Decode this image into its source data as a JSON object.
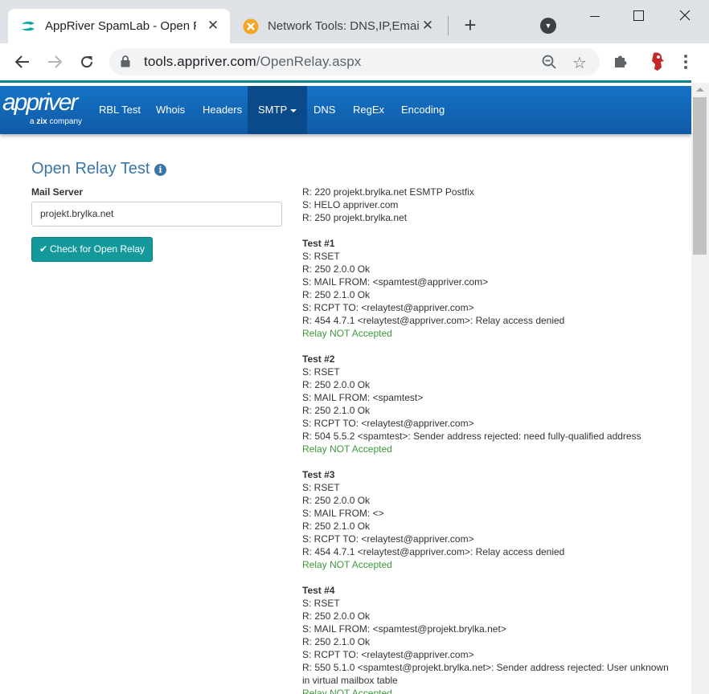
{
  "browser": {
    "tabs": [
      {
        "title": "AppRiver SpamLab - Open Relay Test",
        "active": true,
        "favicon": "appriver-favicon"
      },
      {
        "title": "Network Tools: DNS,IP,Email",
        "active": false,
        "favicon": "network-tools-favicon"
      }
    ],
    "url_host": "tools.appriver.com",
    "url_path": "/OpenRelay.aspx"
  },
  "site": {
    "logo_word": "appriver",
    "logo_tag_prefix": "a ",
    "logo_tag_brand": "zix",
    "logo_tag_suffix": " company",
    "nav": [
      {
        "label": "RBL Test"
      },
      {
        "label": "Whois"
      },
      {
        "label": "Headers"
      },
      {
        "label": "SMTP",
        "active": true
      },
      {
        "label": "DNS"
      },
      {
        "label": "RegEx"
      },
      {
        "label": "Encoding"
      }
    ]
  },
  "form": {
    "heading": "Open Relay Test",
    "mail_server_label": "Mail Server",
    "mail_server_value": "projekt.brylka.net",
    "submit_label": "Check for Open Relay"
  },
  "log": {
    "intro": [
      "R: 220 projekt.brylka.net ESMTP Postfix",
      "S: HELO appriver.com",
      "R: 250 projekt.brylka.net"
    ],
    "tests": [
      {
        "title": "Test #1",
        "lines": [
          "S: RSET",
          "R: 250 2.0.0 Ok",
          "S: MAIL FROM: <spamtest@appriver.com>",
          "R: 250 2.1.0 Ok",
          "S: RCPT TO: <relaytest@appriver.com>",
          "R: 454 4.7.1 <relaytest@appriver.com>: Relay access denied"
        ],
        "result": "Relay NOT Accepted"
      },
      {
        "title": "Test #2",
        "lines": [
          "S: RSET",
          "R: 250 2.0.0 Ok",
          "S: MAIL FROM: <spamtest>",
          "R: 250 2.1.0 Ok",
          "S: RCPT TO: <relaytest@appriver.com>",
          "R: 504 5.5.2 <spamtest>: Sender address rejected: need fully-qualified address"
        ],
        "result": "Relay NOT Accepted"
      },
      {
        "title": "Test #3",
        "lines": [
          "S: RSET",
          "R: 250 2.0.0 Ok",
          "S: MAIL FROM: <>",
          "R: 250 2.1.0 Ok",
          "S: RCPT TO: <relaytest@appriver.com>",
          "R: 454 4.7.1 <relaytest@appriver.com>: Relay access denied"
        ],
        "result": "Relay NOT Accepted"
      },
      {
        "title": "Test #4",
        "lines": [
          "S: RSET",
          "R: 250 2.0.0 Ok",
          "S: MAIL FROM: <spamtest@projekt.brylka.net>",
          "R: 250 2.1.0 Ok",
          "S: RCPT TO: <relaytest@appriver.com>",
          "R: 550 5.1.0 <spamtest@projekt.brylka.net>: Sender address rejected: User unknown in virtual mailbox table"
        ],
        "result": "Relay NOT Accepted"
      }
    ]
  },
  "colors": {
    "nav_bg": "#1673c6",
    "nav_active": "#0b4a8a",
    "heading": "#3a76a8",
    "button": "#13999b",
    "success": "#3c9a3c"
  }
}
